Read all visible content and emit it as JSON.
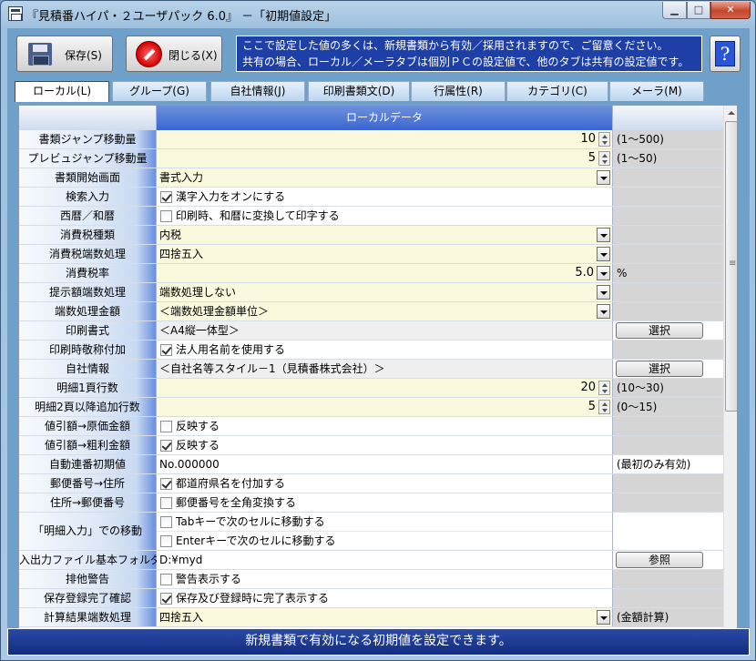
{
  "window": {
    "title": "『見積番ハイパ・２ユーザパック 6.0』 －「初期値設定」",
    "min_glyph": "▁",
    "max_glyph": "□",
    "close_glyph": "✕"
  },
  "toolbar": {
    "save_label": "保存(S)",
    "close_label": "閉じる(X)",
    "notice_line1": "ここで設定した値の多くは、新規書類から有効／採用されますので、ご留意ください。",
    "notice_line2": "共有の場合、ローカル／メーラタブは個別ＰＣの設定値で、他のタブは共有の設定値です。",
    "help_glyph": "?"
  },
  "tabs": [
    {
      "label": "ローカル(L)",
      "active": true
    },
    {
      "label": "グループ(G)",
      "active": false
    },
    {
      "label": "自社情報(J)",
      "active": false
    },
    {
      "label": "印刷書類文(D)",
      "active": false
    },
    {
      "label": "行属性(R)",
      "active": false
    },
    {
      "label": "カテゴリ(C)",
      "active": false
    },
    {
      "label": "メーラ(M)",
      "active": false
    }
  ],
  "grid": {
    "header": "ローカルデータ",
    "rows": [
      {
        "label": "書類ジャンプ移動量",
        "type": "num",
        "value": "10",
        "extra": "(1〜500)"
      },
      {
        "label": "プレビュジャンプ移動量",
        "type": "num",
        "value": "5",
        "extra": "(1〜50)"
      },
      {
        "label": "書類開始画面",
        "type": "select",
        "value": "書式入力",
        "extra": ""
      },
      {
        "label": "検索入力",
        "type": "check",
        "checked": true,
        "value": "漢字入力をオンにする",
        "extra": ""
      },
      {
        "label": "西暦／和暦",
        "type": "check",
        "checked": false,
        "value": "印刷時、和暦に変換して印字する",
        "extra": ""
      },
      {
        "label": "消費税種類",
        "type": "select",
        "value": "内税",
        "extra": ""
      },
      {
        "label": "消費税端数処理",
        "type": "select",
        "value": "四捨五入",
        "extra": ""
      },
      {
        "label": "消費税率",
        "type": "numsel",
        "value": "5.0",
        "extra": "%"
      },
      {
        "label": "提示額端数処理",
        "type": "select",
        "value": "端数処理しない",
        "extra": ""
      },
      {
        "label": "端数処理金額",
        "type": "select",
        "value": "＜端数処理金額単位＞",
        "extra": ""
      },
      {
        "label": "印刷書式",
        "type": "gray",
        "value": "＜A4縦一体型＞",
        "button": "選択"
      },
      {
        "label": "印刷時敬称付加",
        "type": "check",
        "checked": true,
        "value": "法人用名前を使用する",
        "extra": ""
      },
      {
        "label": "自社情報",
        "type": "gray",
        "value": "＜自社名等スタイル－1（見積番株式会社）＞",
        "button": "選択"
      },
      {
        "label": "明細1頁行数",
        "type": "num",
        "value": "20",
        "extra": "(10〜30)"
      },
      {
        "label": "明細2頁以降追加行数",
        "type": "num",
        "value": "5",
        "extra": "(0〜15)"
      },
      {
        "label": "値引額→原価金額",
        "type": "check",
        "checked": false,
        "value": "反映する",
        "extra": ""
      },
      {
        "label": "値引額→粗利金額",
        "type": "check",
        "checked": true,
        "value": "反映する",
        "extra": ""
      },
      {
        "label": "自動連番初期値",
        "type": "text",
        "value": "No.000000",
        "extra": "(最初のみ有効)"
      },
      {
        "label": "郵便番号→住所",
        "type": "check",
        "checked": true,
        "value": "都道府県名を付加する",
        "extra": ""
      },
      {
        "label": "住所→郵便番号",
        "type": "check",
        "checked": false,
        "value": "郵便番号を全角変換する",
        "extra": ""
      },
      {
        "label": "「明細入力」での移動",
        "type": "check2",
        "items": [
          {
            "checked": false,
            "value": "Tabキーで次のセルに移動する"
          },
          {
            "checked": false,
            "value": "Enterキーで次のセルに移動する"
          }
        ],
        "extra": ""
      },
      {
        "label": "入出力ファイル基本フォルダ",
        "type": "textbtn",
        "value": "D:¥myd",
        "button": "参照"
      },
      {
        "label": "排他警告",
        "type": "check",
        "checked": false,
        "value": "警告表示する",
        "extra": ""
      },
      {
        "label": "保存登録完了確認",
        "type": "check",
        "checked": true,
        "value": "保存及び登録時に完了表示する",
        "extra": ""
      },
      {
        "label": "計算結果端数処理",
        "type": "select",
        "value": "四捨五入",
        "extra": "(金額計算)"
      }
    ]
  },
  "statusbar": {
    "text": "新規書類で有効になる初期値を設定できます。"
  }
}
